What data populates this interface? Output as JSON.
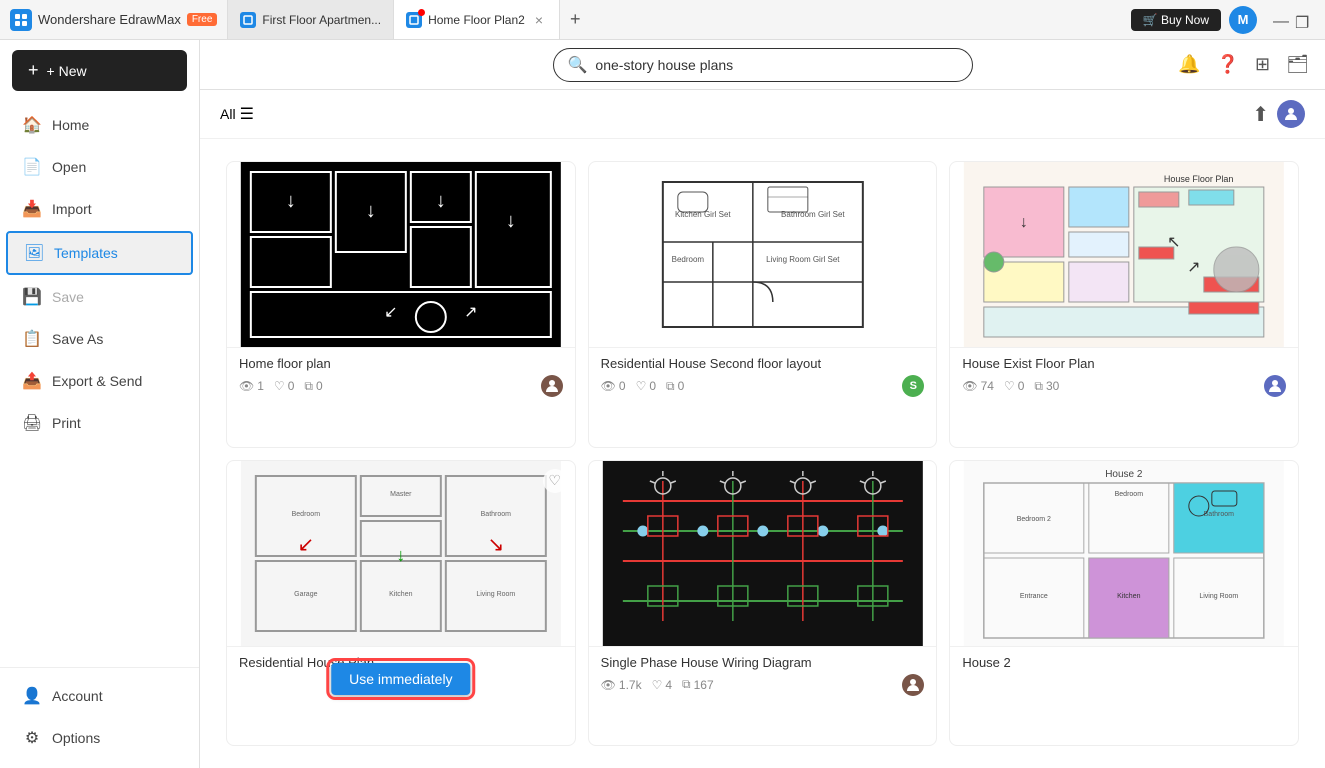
{
  "titlebar": {
    "app_name": "Wondershare EdrawMax",
    "free_badge": "Free",
    "tabs": [
      {
        "id": "tab1",
        "label": "First Floor Apartmen...",
        "active": false,
        "has_dot": false
      },
      {
        "id": "tab2",
        "label": "Home Floor Plan2",
        "active": true,
        "has_dot": true
      }
    ],
    "buy_now": "🛒 Buy Now",
    "minimize": "—",
    "maximize": "❐",
    "user_avatar": "M"
  },
  "sidebar": {
    "new_button": "+ New",
    "nav_items": [
      {
        "id": "home",
        "label": "Home",
        "icon": "🏠",
        "active": false,
        "disabled": false
      },
      {
        "id": "open",
        "label": "Open",
        "icon": "📄",
        "active": false,
        "disabled": false
      },
      {
        "id": "import",
        "label": "Import",
        "icon": "📥",
        "active": false,
        "disabled": false
      },
      {
        "id": "templates",
        "label": "Templates",
        "icon": "🖼",
        "active": true,
        "disabled": false
      },
      {
        "id": "save",
        "label": "Save",
        "icon": "💾",
        "active": false,
        "disabled": true
      },
      {
        "id": "save_as",
        "label": "Save As",
        "icon": "📋",
        "active": false,
        "disabled": false
      },
      {
        "id": "export_send",
        "label": "Export & Send",
        "icon": "📤",
        "active": false,
        "disabled": false
      },
      {
        "id": "print",
        "label": "Print",
        "icon": "🖨",
        "active": false,
        "disabled": false
      }
    ],
    "bottom_items": [
      {
        "id": "account",
        "label": "Account",
        "icon": "👤"
      },
      {
        "id": "options",
        "label": "Options",
        "icon": "⚙"
      }
    ]
  },
  "header": {
    "search_placeholder": "one-story house plans",
    "search_value": "one-story house plans",
    "filter_label": "All",
    "icons": [
      "🔔",
      "❓",
      "⊞",
      "🗂"
    ]
  },
  "templates": [
    {
      "id": "tpl1",
      "title": "Home floor plan",
      "views": "1",
      "likes": "0",
      "copies": "0",
      "thumb_type": "black",
      "has_avatar": true,
      "avatar_color": "#795548",
      "avatar_text": ""
    },
    {
      "id": "tpl2",
      "title": "Residential House Second floor layout",
      "views": "0",
      "likes": "0",
      "copies": "0",
      "thumb_type": "white_plan",
      "has_avatar": true,
      "avatar_color": "#4caf50",
      "avatar_text": "S"
    },
    {
      "id": "tpl3",
      "title": "House Exist Floor Plan",
      "views": "74",
      "likes": "0",
      "copies": "30",
      "thumb_type": "colored_plan",
      "has_avatar": true,
      "avatar_color": "#5c6bc0",
      "avatar_text": ""
    },
    {
      "id": "tpl4",
      "title": "Residential House Plan",
      "views": "",
      "likes": "",
      "copies": "",
      "thumb_type": "house_plan2",
      "has_avatar": false,
      "has_use_btn": true,
      "use_btn_label": "Use immediately"
    },
    {
      "id": "tpl5",
      "title": "Single Phase House Wiring Diagram",
      "views": "1.7k",
      "likes": "4",
      "copies": "167",
      "thumb_type": "wiring_dark",
      "has_avatar": true,
      "avatar_color": "#795548",
      "avatar_text": ""
    },
    {
      "id": "tpl6",
      "title": "House 2",
      "views": "",
      "likes": "",
      "copies": "",
      "thumb_type": "house2_plan",
      "has_avatar": false
    }
  ]
}
